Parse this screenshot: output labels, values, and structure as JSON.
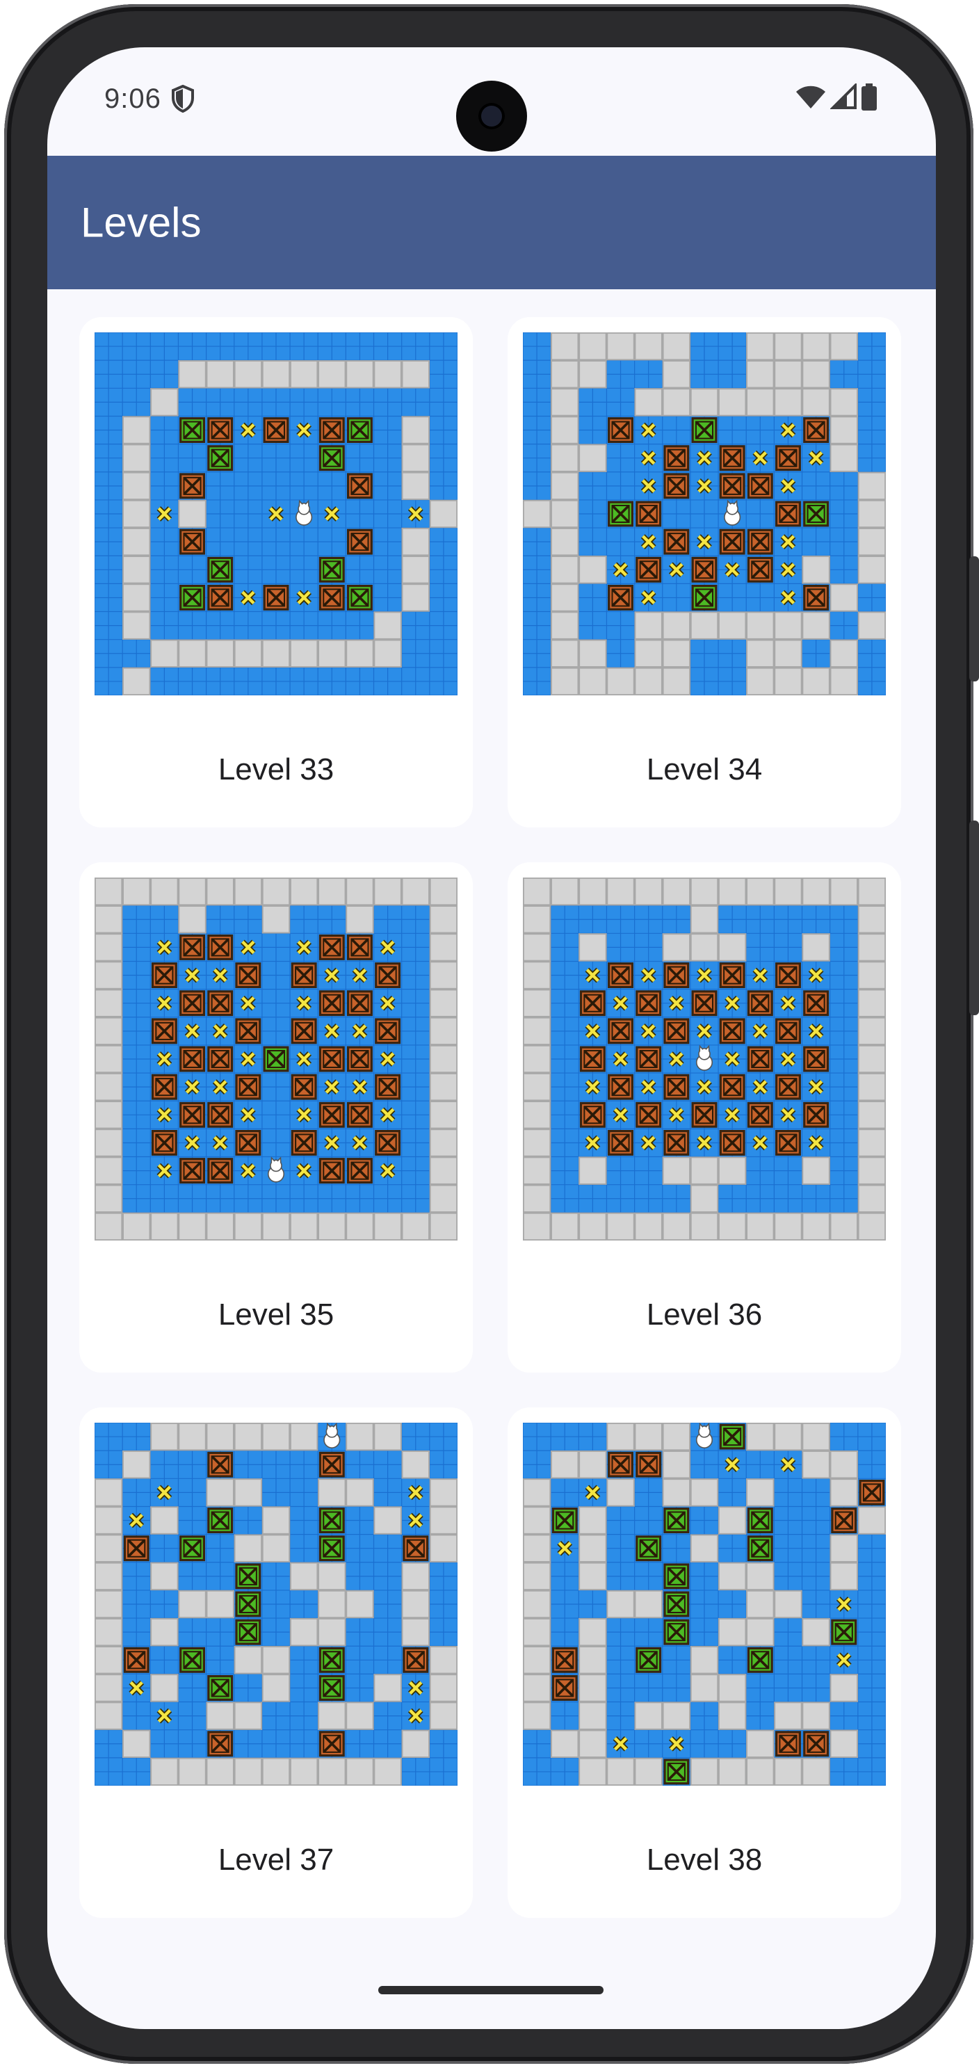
{
  "status_bar": {
    "time": "9:06"
  },
  "app_bar": {
    "title": "Levels"
  },
  "colors": {
    "app_bar": "#455c8f",
    "water": "#2b8de8",
    "wall": "#d4d4d4",
    "box_orange": "#c8632b",
    "box_green": "#4cba24",
    "target": "#f4e542"
  },
  "levels": [
    {
      "label": "Level 33",
      "map": [
        "             ",
        "   ......... ",
        "  .          ",
        " . GB*B*BG . ",
        " .  G   G  . ",
        " . B     B . ",
        " .*.  *@*  *.",
        " . B     B . ",
        " .  G   G  . ",
        " . GB*B*BG . ",
        " .        .  ",
        "  .........  ",
        " .           "
      ]
    },
    {
      "label": "Level 34",
      "map": [
        " .....  .... ",
        " ..  .  ...  ",
        " .  ........ ",
        " . B* G  *B. ",
        " .. *B*B*B*. ",
        " .  *B*BB*  .",
        ".. GB  @ BG .",
        " .  *B*BB*  .",
        " ..*B*B*B*. .",
        " . B* G  *B. ",
        " .  ....... .",
        " .. ..  .. . ",
        " .....  .... "
      ]
    },
    {
      "label": "Level 35",
      "map": [
        ".............",
        ".  .  .  .  .",
        ". *BB* *BB* .",
        ". B**B B**B .",
        ". *BB* *BB* .",
        ". B**B B**B .",
        ". *BB*G*BB* .",
        ". B**B B**B .",
        ". *BB* *BB* .",
        ". B**B B**B .",
        ". *BB*@*BB* .",
        ".           .",
        "............."
      ]
    },
    {
      "label": "Level 36",
      "map": [
        ".............",
        ".     .     .",
        ". .  ...  . .",
        ". *B*B*B*B* .",
        ". B*B*B*B*B .",
        ". *B*B*B*B* .",
        ". B*B*@*B*B .",
        ". *B*B*B*B* .",
        ". B*B*B*B*B .",
        ". *B*B*B*B* .",
        ". .  ...  . .",
        ".     .     .",
        "............."
      ]
    },
    {
      "label": "Level 37",
      "map": [
        "  ......@..  ",
        " .  B   B  . ",
        ". * ..  .. *.",
        ".*. G . G .*.",
        ".B G .. G  B.",
        ". .  G ..  . ",
        ".  ..G  .. . ",
        ". .  G ..  . ",
        ".B G .. G  B.",
        ".*. G . G .*.",
        ". * ..  .. *.",
        " .  B   B  . ",
        "  .........  "
      ]
    },
    {
      "label": "Level 38",
      "map": [
        "   ...@G...  ",
        " ..BB. * *.. ",
        ". *. .. .  .B",
        ".G.  G .G  B.",
        ".*. G . G  . ",
        ". .  G ..  . ",
        ".  ..G  .. * ",
        ". .  G .. .G ",
        ".B. G . G  * ",
        ".B.   ..   . ",
        ". . .. . ..  ",
        " ..* *  .BB. ",
        "  ...G.....  "
      ]
    }
  ]
}
